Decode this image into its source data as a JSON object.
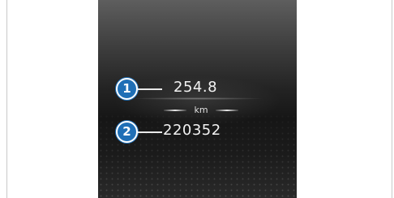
{
  "callouts": [
    {
      "number": "1",
      "value": "254.8"
    },
    {
      "number": "2",
      "value": "220352"
    }
  ],
  "unit": "km",
  "colors": {
    "marker": "#1f6fb6",
    "text": "#f2f2f2",
    "screen_top": "#5e5e5e",
    "screen_bottom": "#161616"
  }
}
